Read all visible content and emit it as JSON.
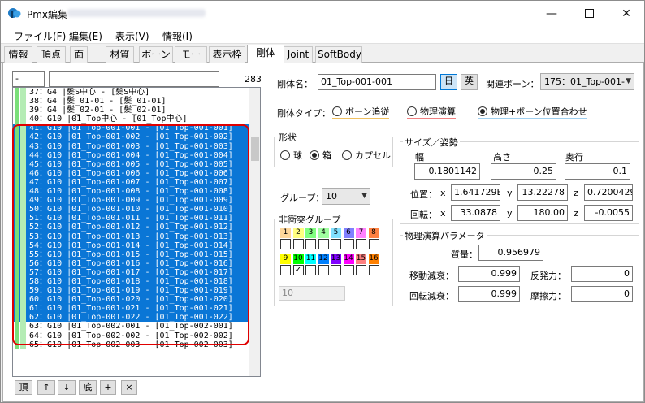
{
  "window": {
    "title": "Pmx編集 -"
  },
  "menu": [
    "ファイル(F)",
    "編集(E)",
    "表示(V)",
    "情報(I)"
  ],
  "tabs": [
    "情報",
    "頂点",
    "面",
    "材質",
    "ボーン",
    "モーフ",
    "表示枠",
    "剛体",
    "Joint",
    "SoftBody"
  ],
  "active_tab": "剛体",
  "list": {
    "search_value": "-",
    "filter_value": "",
    "count": "283",
    "rows": [
      "37：G4 |髪S中心 - [髪S中心]",
      "38：G4 |髪_01-01 - [髪_01-01]",
      "39：G4 |髪_02-01 - [髪_02-01]",
      "40：G10 |01_Top中心 - [01_Top中心]",
      "41：G10 |01_Top-001-001 - [01_Top-001-001]",
      "42：G10 |01_Top-001-002 - [01_Top-001-002]",
      "43：G10 |01_Top-001-003 - [01_Top-001-003]",
      "44：G10 |01_Top-001-004 - [01_Top-001-004]",
      "45：G10 |01_Top-001-005 - [01_Top-001-005]",
      "46：G10 |01_Top-001-006 - [01_Top-001-006]",
      "47：G10 |01_Top-001-007 - [01_Top-001-007]",
      "48：G10 |01_Top-001-008 - [01_Top-001-008]",
      "49：G10 |01_Top-001-009 - [01_Top-001-009]",
      "50：G10 |01_Top-001-010 - [01_Top-001-010]",
      "51：G10 |01_Top-001-011 - [01_Top-001-011]",
      "52：G10 |01_Top-001-012 - [01_Top-001-012]",
      "53：G10 |01_Top-001-013 - [01_Top-001-013]",
      "54：G10 |01_Top-001-014 - [01_Top-001-014]",
      "55：G10 |01_Top-001-015 - [01_Top-001-015]",
      "56：G10 |01_Top-001-016 - [01_Top-001-016]",
      "57：G10 |01_Top-001-017 - [01_Top-001-017]",
      "58：G10 |01_Top-001-018 - [01_Top-001-018]",
      "59：G10 |01_Top-001-019 - [01_Top-001-019]",
      "60：G10 |01_Top-001-020 - [01_Top-001-020]",
      "61：G10 |01_Top-001-021 - [01_Top-001-021]",
      "62：G10 |01_Top-001-022 - [01_Top-001-022]",
      "63：G10 |01_Top-002-001 - [01_Top-002-001]",
      "64：G10 |01_Top-002-002 - [01_Top-002-002]",
      "65：G10 |01_Top-002-003 - [01_Top-002-003]"
    ],
    "selected_first_index": 4,
    "selected_last_index": 25,
    "buttons": [
      "頂",
      "↑",
      "↓",
      "底",
      "+",
      "×"
    ]
  },
  "body": {
    "name_label": "剛体名：",
    "name_value": "01_Top-001-001",
    "lang_jp": "日",
    "lang_en": "英",
    "bone_label": "関連ボーン：",
    "bone_value": "175：01_Top-001-",
    "type_label": "剛体タイプ：",
    "types": [
      "ボーン追従",
      "物理演算",
      "物理+ボーン位置合わせ"
    ],
    "type_selected": 2,
    "shape_title": "形状",
    "shapes": [
      "球",
      "箱",
      "カプセル"
    ],
    "shape_selected": 1,
    "group_label": "グループ：",
    "group_value": "10",
    "nc_title": "非衝突グループ",
    "nc_numbers": [
      "1",
      "2",
      "3",
      "4",
      "5",
      "6",
      "7",
      "8",
      "9",
      "10",
      "11",
      "12",
      "13",
      "14",
      "15",
      "16"
    ],
    "nc_colors": [
      "#ffd79a",
      "#ffff80",
      "#80ff80",
      "#a0ffa0",
      "#80e0ff",
      "#8080ff",
      "#ff80ff",
      "#ff8040",
      "#ffff00",
      "#00ff00",
      "#00ffff",
      "#0080ff",
      "#8000ff",
      "#ff00ff",
      "#ff8080",
      "#ff8000"
    ],
    "nc_checked": [
      9
    ],
    "nc_value": "10",
    "size_title": "サイズ／姿勢",
    "size_headers": [
      "幅",
      "高さ",
      "奥行"
    ],
    "size_values": [
      "0.1801142",
      "0.25",
      "0.1"
    ],
    "pos_label": "位置：",
    "pos_values": [
      "1.641729E-",
      "13.22278",
      "0.7200429"
    ],
    "rot_label": "回転：",
    "rot_values": [
      "33.0878",
      "180.00",
      "-0.0055"
    ],
    "axis_labels": [
      "x",
      "y",
      "z"
    ],
    "phys_title": "物理演算パラメータ",
    "mass_label": "質量：",
    "mass_value": "0.956979",
    "move_damp_label": "移動減衰：",
    "move_damp_value": "0.999",
    "restitution_label": "反発力：",
    "restitution_value": "0",
    "rot_damp_label": "回転減衰：",
    "rot_damp_value": "0.999",
    "friction_label": "摩擦力：",
    "friction_value": "0"
  }
}
